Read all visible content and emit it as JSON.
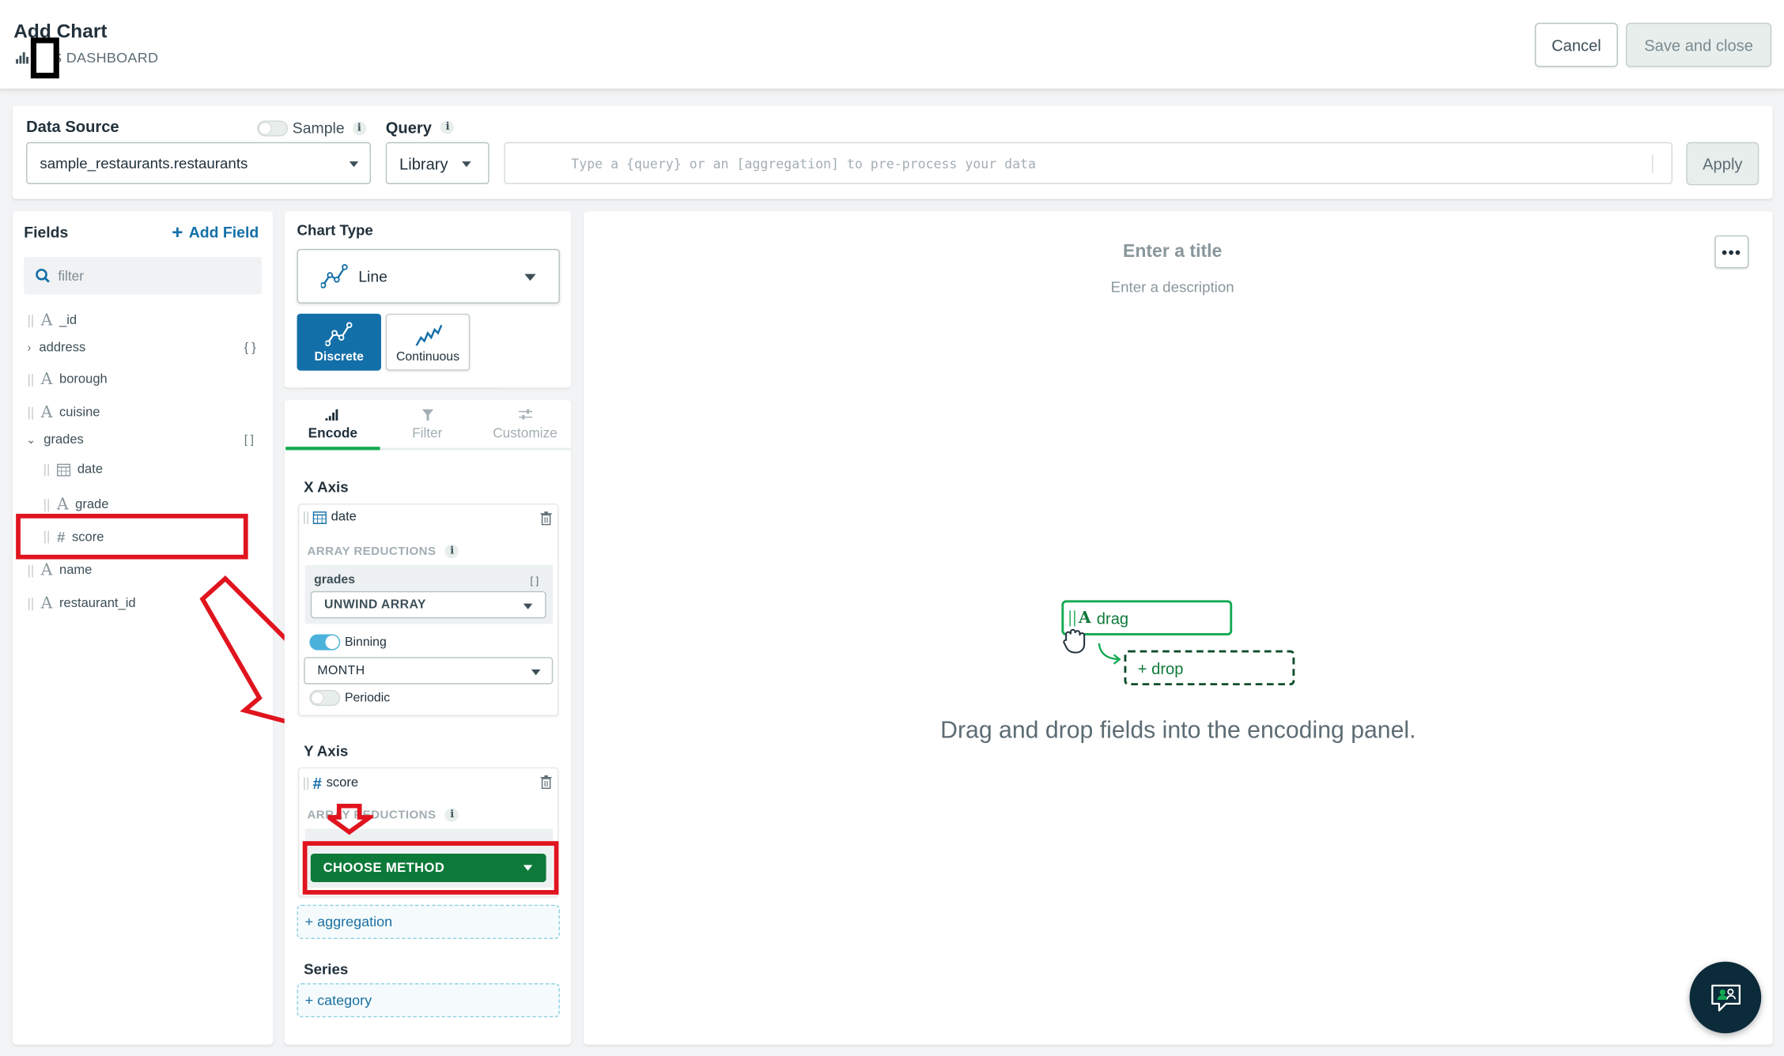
{
  "header": {
    "title": "Add Chart",
    "breadcrumb": "S DASHBOARD",
    "cancel_label": "Cancel",
    "save_label": "Save and close"
  },
  "data_source": {
    "label": "Data Source",
    "sample_label": "Sample",
    "selected": "sample_restaurants.restaurants",
    "query_label": "Query",
    "library_label": "Library",
    "query_placeholder": "Type a {query} or an [aggregation] to pre-process your data",
    "apply_label": "Apply"
  },
  "fields": {
    "title": "Fields",
    "add_field_label": "Add Field",
    "filter_placeholder": "filter",
    "items": [
      {
        "name": "_id",
        "type": "string"
      },
      {
        "name": "address",
        "type": "object",
        "suffix": "{ }"
      },
      {
        "name": "borough",
        "type": "string"
      },
      {
        "name": "cuisine",
        "type": "string"
      },
      {
        "name": "grades",
        "type": "array",
        "suffix": "[ ]"
      },
      {
        "name": "date",
        "type": "date"
      },
      {
        "name": "grade",
        "type": "string"
      },
      {
        "name": "score",
        "type": "number"
      },
      {
        "name": "name",
        "type": "string"
      },
      {
        "name": "restaurant_id",
        "type": "string"
      }
    ]
  },
  "chart_type": {
    "title": "Chart Type",
    "selected": "Line",
    "variants": [
      "Discrete",
      "Continuous"
    ]
  },
  "tabs": [
    "Encode",
    "Filter",
    "Customize"
  ],
  "encode": {
    "x_axis": {
      "title": "X Axis",
      "field": "date",
      "reductions_label": "ARRAY REDUCTIONS",
      "array_name": "grades",
      "reduction": "UNWIND ARRAY",
      "binning_label": "Binning",
      "binning_value": "MONTH",
      "periodic_label": "Periodic"
    },
    "y_axis": {
      "title": "Y Axis",
      "field": "score",
      "reductions_label": "ARRAY REDUCTIONS",
      "reduction": "CHOOSE METHOD",
      "aggregation_label": "+ aggregation"
    },
    "series": {
      "title": "Series",
      "category_label": "+ category"
    }
  },
  "canvas": {
    "title_placeholder": "Enter a title",
    "description_placeholder": "Enter a description",
    "drag_label": "drag",
    "drop_label": "+ drop",
    "hint": "Drag and drop fields into the encoding panel."
  },
  "colors": {
    "accent_green": "#13aa52",
    "primary_blue": "#136fa8",
    "choose_method_green": "#0e7a3a",
    "annotation_red": "#e0141e"
  }
}
